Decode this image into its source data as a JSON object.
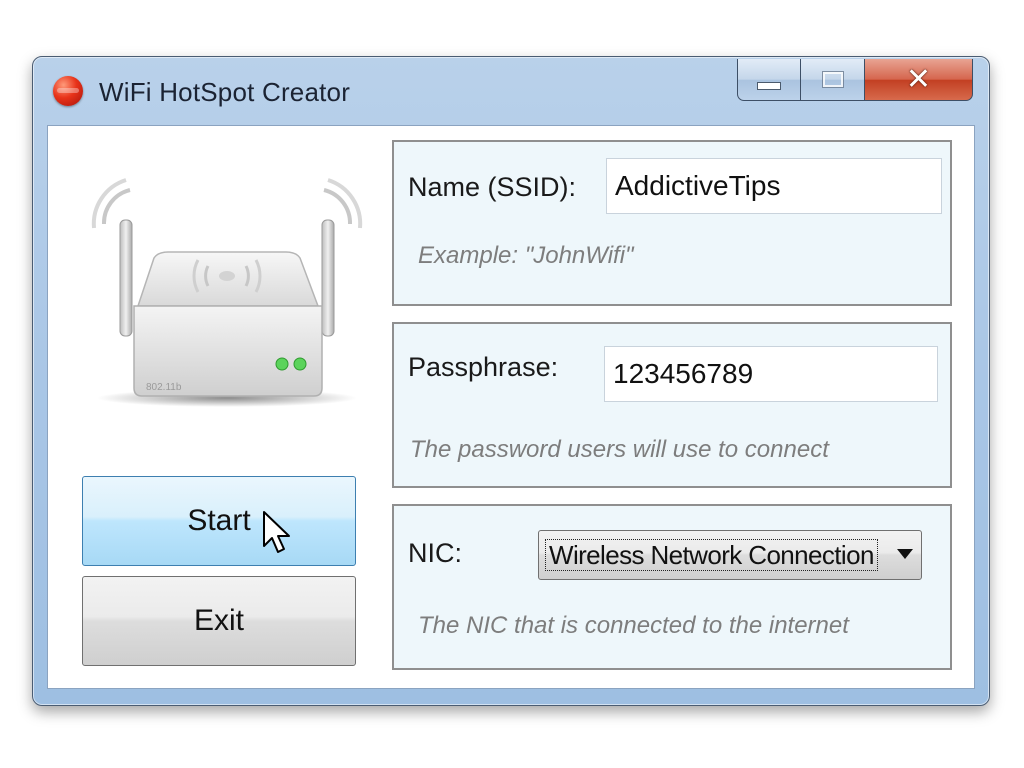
{
  "window": {
    "title": "WiFi HotSpot Creator",
    "icon": "app-icon",
    "caption_buttons": {
      "minimize_icon": "minimize-icon",
      "maximize_icon": "maximize-icon",
      "close_icon": "close-icon",
      "close_glyph": "✕"
    }
  },
  "illustration": {
    "icon": "wifi-router-icon",
    "device_label": "802.11b"
  },
  "buttons": {
    "start_label": "Start",
    "exit_label": "Exit"
  },
  "ssid": {
    "label": "Name (SSID):",
    "value": "AddictiveTips",
    "hint": "Example: \"JohnWifi\""
  },
  "passphrase": {
    "label": "Passphrase:",
    "value": "123456789",
    "hint": "The password users will use to connect"
  },
  "nic": {
    "label": "NIC:",
    "selected": "Wireless Network Connection",
    "hint": "The NIC that is connected to the internet",
    "dropdown_icon": "chevron-down-icon"
  },
  "colors": {
    "titlebar": "#b9d1ea",
    "close_button": "#c94a2e",
    "start_button": "#bee6fd",
    "group_background": "#eef7fb",
    "hint_text": "#7d7d7d"
  }
}
